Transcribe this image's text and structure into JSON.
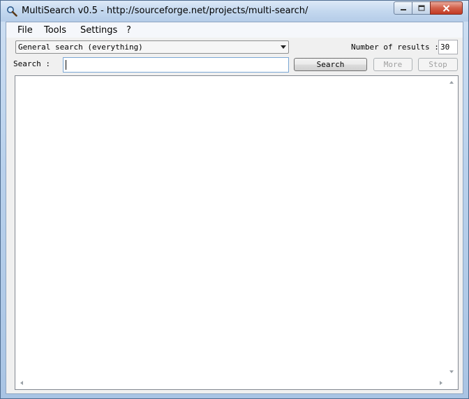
{
  "window": {
    "title": "MultiSearch v0.5 - http://sourceforge.net/projects/multi-search/",
    "app_icon": "magnifier-icon",
    "controls": {
      "minimize_icon": "minimize-icon",
      "maximize_icon": "maximize-icon",
      "close_icon": "close-icon"
    }
  },
  "menu": {
    "items": [
      {
        "label": "File"
      },
      {
        "label": "Tools"
      },
      {
        "label": "Settings"
      },
      {
        "label": "?"
      }
    ]
  },
  "search_type": {
    "selected": "General search (everything)"
  },
  "results_count": {
    "label": "Number of results :",
    "value": "30"
  },
  "search": {
    "label": "Search :",
    "value": ""
  },
  "buttons": {
    "search": "Search",
    "more": "More",
    "stop": "Stop"
  },
  "results": {
    "items": []
  },
  "colors": {
    "title_bar": "#c4d8ef",
    "close_button": "#c9452f",
    "focus_border": "#7aa7d4"
  }
}
